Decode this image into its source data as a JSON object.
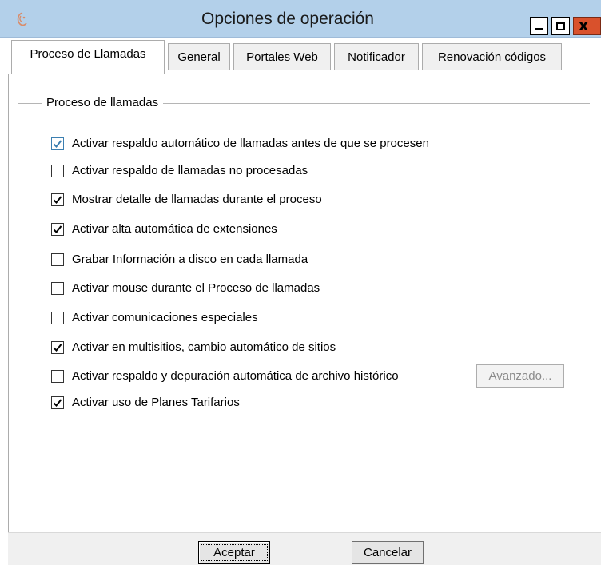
{
  "window": {
    "title": "Opciones de operación",
    "close_glyph": "x"
  },
  "tabs": [
    {
      "label": "Proceso de Llamadas",
      "active": true
    },
    {
      "label": "General",
      "active": false
    },
    {
      "label": "Portales Web",
      "active": false
    },
    {
      "label": "Notificador",
      "active": false
    },
    {
      "label": "Renovación códigos",
      "active": false
    }
  ],
  "group": {
    "label": "Proceso de llamadas"
  },
  "options": [
    {
      "label": "Activar respaldo automático de llamadas antes de que se procesen",
      "checked": true
    },
    {
      "label": "Activar respaldo de llamadas no procesadas",
      "checked": false
    },
    {
      "label": "Mostrar detalle de llamadas durante el proceso",
      "checked": true
    },
    {
      "label": "Activar alta automática de extensiones",
      "checked": true
    },
    {
      "label": "Grabar Información a disco en cada llamada",
      "checked": false
    },
    {
      "label": "Activar mouse durante el Proceso de llamadas",
      "checked": false
    },
    {
      "label": "Activar comunicaciones especiales",
      "checked": false
    },
    {
      "label": "Activar en multisitios, cambio automático de sitios",
      "checked": true
    },
    {
      "label": "Activar respaldo y depuración automática de archivo histórico",
      "checked": false
    },
    {
      "label": "Activar uso de Planes Tarifarios",
      "checked": true
    }
  ],
  "advanced_button": {
    "label": "Avanzado..."
  },
  "footer": {
    "accept_label": "Aceptar",
    "cancel_label": "Cancelar"
  },
  "colors": {
    "titlebar": "#b3d0ea",
    "close_button": "#d9512c",
    "check_highlight": "#3c7fb1"
  }
}
